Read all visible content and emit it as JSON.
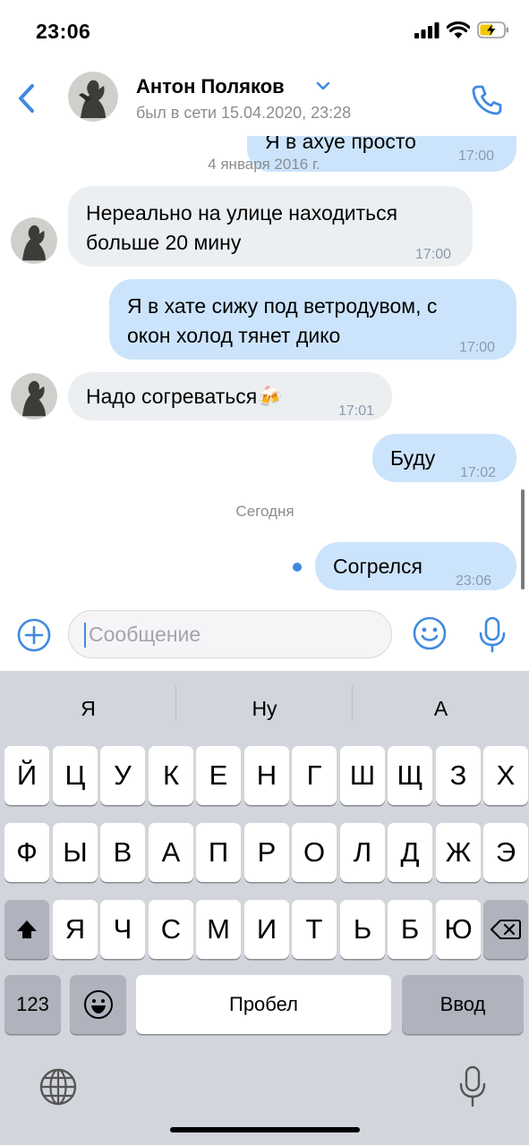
{
  "status_bar": {
    "time": "23:06"
  },
  "header": {
    "contact_name": "Антон Поляков",
    "contact_status": "был в сети 15.04.2020, 23:28"
  },
  "chat": {
    "top_partial": {
      "text": "Я в ахуе просто",
      "time": "17:00"
    },
    "date_sep_1": "4 января 2016 г.",
    "messages": [
      {
        "text": "Нереально на улице находиться\nбольше 20 мину",
        "time": "17:00"
      },
      {
        "text": "Я в хате сижу под ветродувом, с\nокон холод тянет дико",
        "time": "17:00"
      },
      {
        "text": "Надо согреваться",
        "emoji": "🍻",
        "time": "17:01"
      },
      {
        "text": "Буду",
        "time": "17:02"
      }
    ],
    "date_sep_2": "Сегодня",
    "last_message": {
      "text": "Согрелся",
      "time": "23:06"
    }
  },
  "input": {
    "placeholder": "Сообщение"
  },
  "keyboard": {
    "suggestions": [
      "Я",
      "Ну",
      "А"
    ],
    "row1": [
      "Й",
      "Ц",
      "У",
      "К",
      "Е",
      "Н",
      "Г",
      "Ш",
      "Щ",
      "З",
      "Х"
    ],
    "row2": [
      "Ф",
      "Ы",
      "В",
      "А",
      "П",
      "Р",
      "О",
      "Л",
      "Д",
      "Ж",
      "Э"
    ],
    "row3": [
      "Я",
      "Ч",
      "С",
      "М",
      "И",
      "Т",
      "Ь",
      "Б",
      "Ю"
    ],
    "numbers_label": "123",
    "space_label": "Пробел",
    "return_label": "Ввод"
  },
  "colors": {
    "accent": "#3f8ae0",
    "bubble_in": "#eceff2",
    "bubble_out": "#cce4fb",
    "keyboard_bg": "#d2d5db"
  }
}
